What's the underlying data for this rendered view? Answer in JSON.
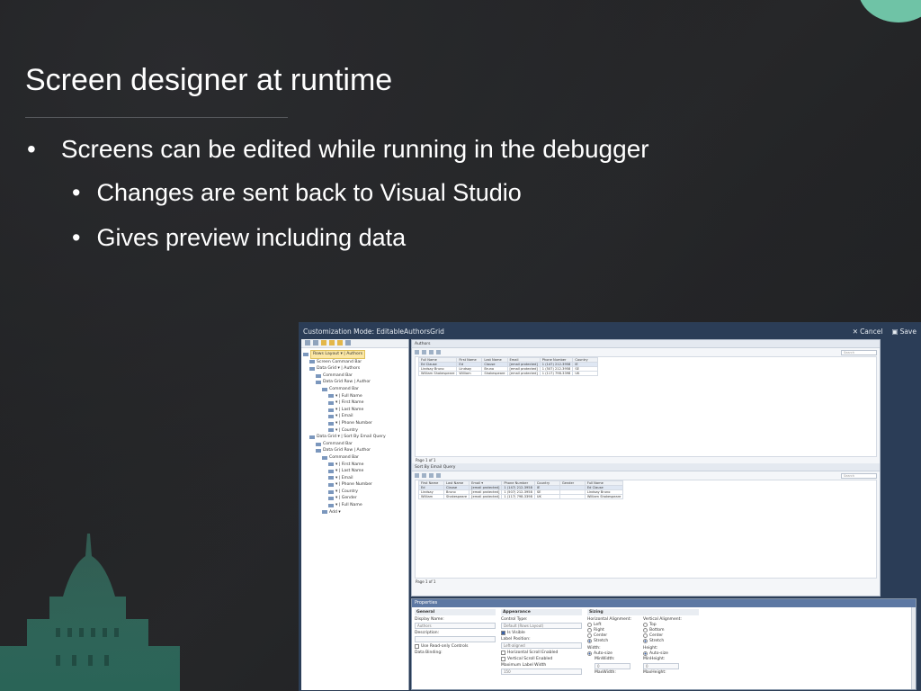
{
  "slide": {
    "title": "Screen designer at runtime",
    "bullets": [
      {
        "text": "Screens can be edited while running in the debugger",
        "level": 1
      },
      {
        "text": "Changes are sent back to Visual Studio",
        "level": 2
      },
      {
        "text": "Gives preview including data",
        "level": 2
      }
    ],
    "bullet_glyph": "•"
  },
  "screenshot": {
    "title": "Customization Mode: EditableAuthorsGrid",
    "cancel_label": "Cancel",
    "save_label": "Save",
    "tree": [
      {
        "label": "Rows Layout ▾ | Authors",
        "selected": true
      },
      {
        "label": "Screen Command Bar"
      },
      {
        "label": "Data Grid ▾ | Authors"
      },
      {
        "label": "Command Bar"
      },
      {
        "label": "Data Grid Row | Author"
      },
      {
        "label": "Command Bar"
      },
      {
        "label": "▾ | Full Name"
      },
      {
        "label": "▾ | First Name"
      },
      {
        "label": "▾ | Last Name"
      },
      {
        "label": "▾ | Email"
      },
      {
        "label": "▾ | Phone Number"
      },
      {
        "label": "▾ | Country"
      },
      {
        "label": "Data Grid ▾ | Sort By Email Query"
      },
      {
        "label": "Command Bar"
      },
      {
        "label": "Data Grid Row | Author"
      },
      {
        "label": "Command Bar"
      },
      {
        "label": "▾ | First Name"
      },
      {
        "label": "▾ | Last Name"
      },
      {
        "label": "▾ | Email"
      },
      {
        "label": "▾ | Phone Number"
      },
      {
        "label": "▾ | Country"
      },
      {
        "label": "▾ | Gender"
      },
      {
        "label": "▾ | Full Name"
      },
      {
        "label": "Add ▾"
      }
    ],
    "grid1": {
      "header": "Authors",
      "search_placeholder": "Search",
      "columns": [
        "Full Name",
        "First Name",
        "Last Name",
        "Email",
        "Phone Number",
        "Country"
      ],
      "rows": [
        [
          "Ed Clause",
          "Ed",
          "Clause",
          "[email protected]",
          "1 (147) 212-3958",
          "IE"
        ],
        [
          "Lindsay Bruno",
          "Lindsay",
          "Bruno",
          "[email protected]",
          "1 (507) 212-3958",
          "SE"
        ],
        [
          "William Shakespeare",
          "William",
          "Shakespeare",
          "[email protected]",
          "1 (117) 798-3398",
          "UK"
        ]
      ],
      "pager": "Page 1 of 1"
    },
    "grid2": {
      "header": "Sort By Email Query",
      "search_placeholder": "Search",
      "columns": [
        "First Name",
        "Last Name",
        "Email ▾",
        "Phone Number",
        "Country",
        "Gender",
        "Full Name"
      ],
      "rows": [
        [
          "Ed",
          "Clause",
          "[email protected]",
          "1 (147) 212-3958",
          "IE",
          "",
          "Ed Clause"
        ],
        [
          "Lindsay",
          "Bruno",
          "[email protected]",
          "1 (507) 212-3958",
          "SE",
          "",
          "Lindsay Bruno"
        ],
        [
          "William",
          "Shakespeare",
          "[email protected]",
          "1 (117) 798-3398",
          "UK",
          "",
          "William Shakespeare"
        ]
      ],
      "pager": "Page 1 of 1"
    },
    "properties": {
      "title": "Properties",
      "general": {
        "heading": "General",
        "display_name_label": "Display Name:",
        "display_name_value": "Authors",
        "description_label": "Description:",
        "readonly_label": "Use Read-only Controls",
        "data_binding_label": "Data Binding:"
      },
      "appearance": {
        "heading": "Appearance",
        "control_type_label": "Control Type:",
        "control_type_value": "Default (Rows Layout)",
        "is_visible_label": "Is Visible",
        "label_position_label": "Label Position:",
        "label_position_value": "Left-aligned",
        "hscroll_label": "Horizontal Scroll Enabled",
        "vscroll_label": "Vertical Scroll Enabled",
        "max_label_width_label": "Maximum Label Width",
        "max_label_width_value": "150"
      },
      "sizing": {
        "heading": "Sizing",
        "h_align_label": "Horizontal Alignment:",
        "v_align_label": "Vertical Alignment:",
        "h_options": [
          "Left",
          "Right",
          "Center",
          "Stretch"
        ],
        "v_options": [
          "Top",
          "Bottom",
          "Center",
          "Stretch"
        ],
        "width_label": "Width:",
        "height_label": "Height:",
        "auto_size_label": "Auto-size",
        "min_width_label": "MinWidth:",
        "min_height_label": "MinHeight:",
        "min_width_value": "0",
        "min_height_value": "0",
        "max_width_label": "MaxWidth:",
        "max_height_label": "MaxHeight:"
      }
    }
  }
}
